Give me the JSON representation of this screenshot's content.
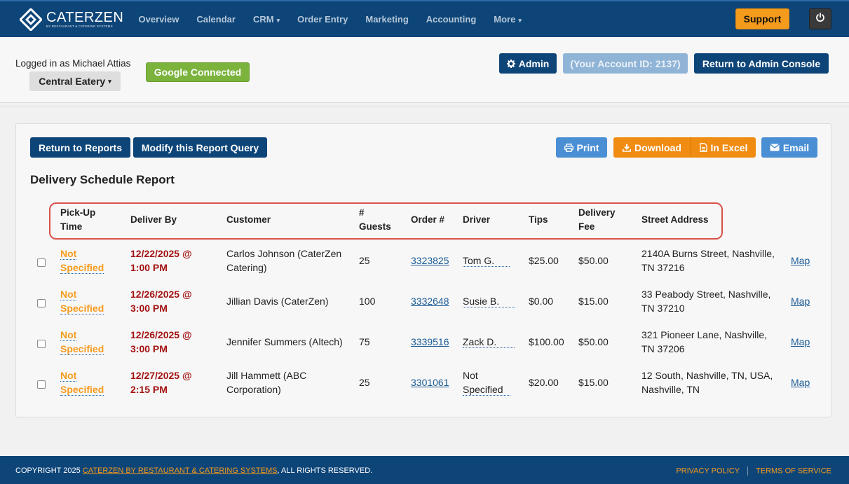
{
  "brand": {
    "name": "CATERZEN",
    "tagline": "BY RESTAURANT & CATERING SYSTEMS"
  },
  "nav": {
    "items": [
      {
        "label": "Overview",
        "caret": ""
      },
      {
        "label": "Calendar",
        "caret": ""
      },
      {
        "label": "CRM",
        "caret": "▾"
      },
      {
        "label": "Order Entry",
        "caret": ""
      },
      {
        "label": "Marketing",
        "caret": ""
      },
      {
        "label": "Accounting",
        "caret": ""
      },
      {
        "label": "More",
        "caret": "▾"
      }
    ],
    "support_label": "Support"
  },
  "account": {
    "logged_in_text": "Logged in as Michael Attias",
    "location": "Central Eatery",
    "google_label": "Google Connected",
    "admin_label": "Admin",
    "account_id_label": "(Your Account ID: 2137)",
    "return_admin_label": "Return to Admin Console"
  },
  "report": {
    "return_label": "Return to Reports",
    "modify_label": "Modify this Report Query",
    "print_label": "Print",
    "download_label": "Download",
    "excel_label": "In Excel",
    "email_label": "Email",
    "title": "Delivery Schedule Report",
    "columns": {
      "pickup_1": "Pick-Up",
      "pickup_2": "Time",
      "deliver": "Deliver By",
      "customer": "Customer",
      "guests_1": "#",
      "guests_2": "Guests",
      "order": "Order #",
      "driver": "Driver",
      "tips": "Tips",
      "fee_1": "Delivery",
      "fee_2": "Fee",
      "address": "Street Address"
    },
    "rows": [
      {
        "pickup_1": "Not",
        "pickup_2": "Specified",
        "deliver_1": "12/22/2025 @",
        "deliver_2": "1:00 PM",
        "customer_1": "Carlos Johnson (CaterZen",
        "customer_2": "Catering)",
        "guests": "25",
        "order": "3323825",
        "driver_1": "Tom G.",
        "driver_2": "",
        "tips": "$25.00",
        "fee": "$50.00",
        "address_1": "2140A Burns Street, Nashville,",
        "address_2": "TN 37216",
        "map": "Map"
      },
      {
        "pickup_1": "Not",
        "pickup_2": "Specified",
        "deliver_1": "12/26/2025 @",
        "deliver_2": "3:00 PM",
        "customer_1": "Jillian Davis (CaterZen)",
        "customer_2": "",
        "guests": "100",
        "order": "3332648",
        "driver_1": "Susie B.",
        "driver_2": "",
        "tips": "$0.00",
        "fee": "$15.00",
        "address_1": "33 Peabody Street, Nashville,",
        "address_2": "TN 37210",
        "map": "Map"
      },
      {
        "pickup_1": "Not",
        "pickup_2": "Specified",
        "deliver_1": "12/26/2025 @",
        "deliver_2": "3:00 PM",
        "customer_1": "Jennifer Summers (Altech)",
        "customer_2": "",
        "guests": "75",
        "order": "3339516",
        "driver_1": "Zack D.",
        "driver_2": "",
        "tips": "$100.00",
        "fee": "$50.00",
        "address_1": "321 Pioneer Lane, Nashville,",
        "address_2": "TN 37206",
        "map": "Map"
      },
      {
        "pickup_1": "Not",
        "pickup_2": "Specified",
        "deliver_1": "12/27/2025 @",
        "deliver_2": "2:15 PM",
        "customer_1": "Jill Hammett (ABC",
        "customer_2": "Corporation)",
        "guests": "25",
        "order": "3301061",
        "driver_1": "Not",
        "driver_2": "Specified",
        "tips": "$20.00",
        "fee": "$15.00",
        "address_1": "12 South, Nashville, TN, USA,",
        "address_2": "Nashville, TN",
        "map": "Map"
      }
    ]
  },
  "footer": {
    "copyright_prefix": "COPYRIGHT 2025",
    "org": "CATERZEN BY RESTAURANT & CATERING SYSTEMS",
    "rights": ", ALL RIGHTS RESERVED.",
    "privacy": "PRIVACY POLICY",
    "terms": "TERMS OF SERVICE"
  }
}
